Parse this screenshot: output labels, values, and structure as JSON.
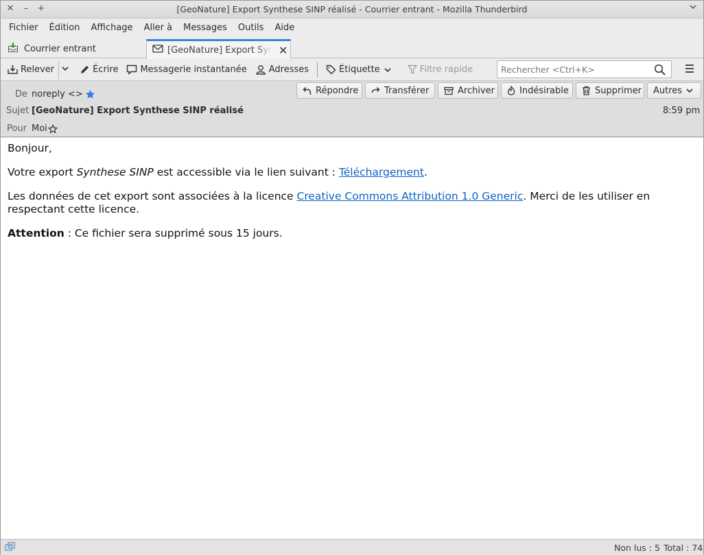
{
  "window": {
    "title": "[GeoNature] Export Synthese SINP réalisé - Courrier entrant - Mozilla Thunderbird",
    "controls": [
      "close-icon",
      "minimize-icon",
      "maximize-icon"
    ]
  },
  "menubar": {
    "items": [
      {
        "label": "Fichier"
      },
      {
        "label": "Édition"
      },
      {
        "label": "Affichage"
      },
      {
        "label": "Aller à"
      },
      {
        "label": "Messages"
      },
      {
        "label": "Outils"
      },
      {
        "label": "Aide"
      }
    ]
  },
  "tabs": [
    {
      "label": "Courrier entrant",
      "icon": "inbox-icon"
    },
    {
      "label": "[GeoNature] Export Synthese SINP réalisé",
      "icon": "envelope-icon",
      "active": true
    }
  ],
  "toolbar": {
    "get_mail": "Relever",
    "write": "Écrire",
    "chat": "Messagerie instantanée",
    "address_book": "Adresses",
    "tag": "Étiquette",
    "quick_filter": "Filtre rapide",
    "search_placeholder": "Rechercher <Ctrl+K>"
  },
  "header": {
    "from_label": "De",
    "from_value": "noreply <>",
    "subject_label": "Sujet",
    "subject_value": "[GeoNature] Export Synthese SINP réalisé",
    "to_label": "Pour",
    "to_value": "Moi",
    "time": "8:59 pm",
    "actions": {
      "reply": "Répondre",
      "forward": "Transférer",
      "archive": "Archiver",
      "junk": "Indésirable",
      "delete": "Supprimer",
      "more": "Autres"
    }
  },
  "body": {
    "greeting": "Bonjour,",
    "line1_pre": "Votre export ",
    "line1_em": "Synthese SINP",
    "line1_mid": " est accessible via le lien suivant : ",
    "line1_link": "Téléchargement",
    "line1_post": ".",
    "line2_pre": "Les données de cet export sont associées à la licence ",
    "line2_link": "Creative Commons Attribution 1.0 Generic",
    "line2_post": ". Merci de les utiliser en respectant cette licence.",
    "line3_bold": "Attention",
    "line3_post": " : Ce fichier sera supprimé sous 15 jours."
  },
  "status": {
    "unread": "Non lus : 5",
    "total": "Total : 74"
  },
  "colors": {
    "link": "#0a62c2",
    "star": "#2f7ee6",
    "active_tab_accent": "#3b86d7"
  }
}
